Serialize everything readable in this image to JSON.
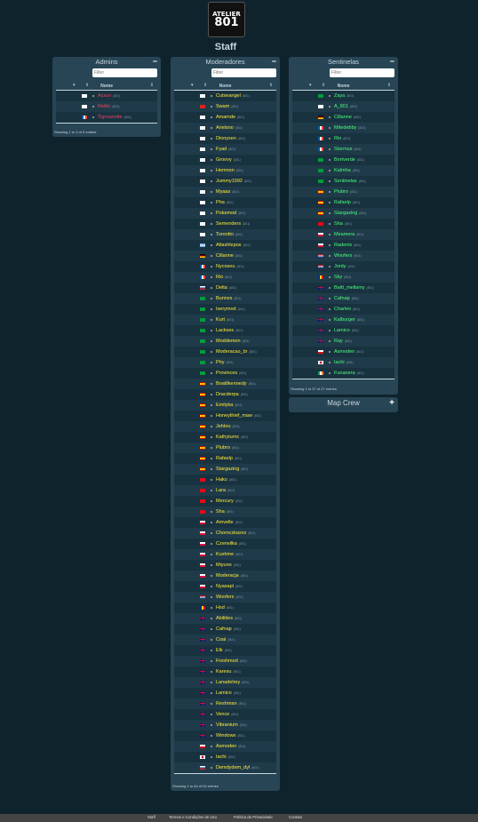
{
  "logo": {
    "line1": "ATELIER",
    "line2": "801"
  },
  "page_title": "Staff",
  "panels": {
    "admins": {
      "title": "Admins",
      "toggle": "−",
      "filter_placeholder": "Filter",
      "col_name": "Nome",
      "info": "Showing 1 to 3 of 3 entries",
      "rows": [
        {
          "name": "Acsun",
          "sub": "(801)",
          "flag": "kr",
          "color": "#f04060"
        },
        {
          "name": "Reitto",
          "sub": "(801)",
          "flag": "kr",
          "color": "#f04060"
        },
        {
          "name": "Tigrounette",
          "sub": "(801)",
          "flag": "fr",
          "color": "#f04060"
        }
      ]
    },
    "moderadores": {
      "title": "Moderadores",
      "toggle": "−",
      "filter_placeholder": "Filter",
      "col_name": "Nome",
      "info": "Showing 1 to 64 of 64 entries",
      "rows": [
        {
          "name": "Cutseangel",
          "sub": "(801)",
          "flag": "kr",
          "color": "#ffeb3b"
        },
        {
          "name": "Swam",
          "sub": "(801)",
          "flag": "vn",
          "color": "#ffeb3b"
        },
        {
          "name": "Amamde",
          "sub": "(801)",
          "flag": "kr",
          "color": "#ffeb3b"
        },
        {
          "name": "Arielsno",
          "sub": "(801)",
          "flag": "kr",
          "color": "#ffeb3b"
        },
        {
          "name": "Dionysen",
          "sub": "(801)",
          "flag": "kr",
          "color": "#ffeb3b"
        },
        {
          "name": "Fyad",
          "sub": "(801)",
          "flag": "kr",
          "color": "#ffeb3b"
        },
        {
          "name": "Groovy",
          "sub": "(801)",
          "flag": "kr",
          "color": "#ffeb3b"
        },
        {
          "name": "Hemnon",
          "sub": "(801)",
          "flag": "kr",
          "color": "#ffeb3b"
        },
        {
          "name": "Jummy1992",
          "sub": "(801)",
          "flag": "kr",
          "color": "#ffeb3b"
        },
        {
          "name": "Myaas",
          "sub": "(801)",
          "flag": "kr",
          "color": "#ffeb3b"
        },
        {
          "name": "Pha",
          "sub": "(801)",
          "flag": "kr",
          "color": "#ffeb3b"
        },
        {
          "name": "Pokemod",
          "sub": "(801)",
          "flag": "kr",
          "color": "#ffeb3b"
        },
        {
          "name": "Semenders",
          "sub": "(801)",
          "flag": "kr",
          "color": "#ffeb3b"
        },
        {
          "name": "Torontto",
          "sub": "(801)",
          "flag": "kr",
          "color": "#ffeb3b"
        },
        {
          "name": "Atlashlepos",
          "sub": "(801)",
          "flag": "ar",
          "color": "#ffeb3b"
        },
        {
          "name": "Cillanne",
          "sub": "(801)",
          "flag": "de",
          "color": "#ffeb3b"
        },
        {
          "name": "Nycoseu",
          "sub": "(801)",
          "flag": "fr",
          "color": "#ffeb3b"
        },
        {
          "name": "Rio",
          "sub": "(801)",
          "flag": "fr",
          "color": "#ffeb3b"
        },
        {
          "name": "Delta",
          "sub": "(801)",
          "flag": "ru",
          "color": "#ffeb3b"
        },
        {
          "name": "Bunnxs",
          "sub": "(801)",
          "flag": "br",
          "color": "#ffeb3b"
        },
        {
          "name": "Iserymod",
          "sub": "(801)",
          "flag": "br",
          "color": "#ffeb3b"
        },
        {
          "name": "Kurt",
          "sub": "(801)",
          "flag": "br",
          "color": "#ffeb3b"
        },
        {
          "name": "Lackses",
          "sub": "(801)",
          "flag": "br",
          "color": "#ffeb3b"
        },
        {
          "name": "Moddemon",
          "sub": "(801)",
          "flag": "br",
          "color": "#ffeb3b"
        },
        {
          "name": "Moderacao_br",
          "sub": "(801)",
          "flag": "br",
          "color": "#ffeb3b"
        },
        {
          "name": "Phy",
          "sub": "(801)",
          "flag": "br",
          "color": "#ffeb3b"
        },
        {
          "name": "Provinces",
          "sub": "(801)",
          "flag": "br",
          "color": "#ffeb3b"
        },
        {
          "name": "Boatlikennedy",
          "sub": "(801)",
          "flag": "es",
          "color": "#ffeb3b"
        },
        {
          "name": "Dracderpa",
          "sub": "(801)",
          "flag": "es",
          "color": "#ffeb3b"
        },
        {
          "name": "Emilyka",
          "sub": "(801)",
          "flag": "es",
          "color": "#ffeb3b"
        },
        {
          "name": "Honeythief_maw",
          "sub": "(801)",
          "flag": "es",
          "color": "#ffeb3b"
        },
        {
          "name": "Jehtou",
          "sub": "(801)",
          "flag": "es",
          "color": "#ffeb3b"
        },
        {
          "name": "Kathyturnc",
          "sub": "(801)",
          "flag": "es",
          "color": "#ffeb3b"
        },
        {
          "name": "Plubro",
          "sub": "(801)",
          "flag": "es",
          "color": "#ffeb3b"
        },
        {
          "name": "Rafaelp",
          "sub": "(801)",
          "flag": "es",
          "color": "#ffeb3b"
        },
        {
          "name": "Stargazing",
          "sub": "(801)",
          "flag": "es",
          "color": "#ffeb3b"
        },
        {
          "name": "Haku",
          "sub": "(801)",
          "flag": "tr",
          "color": "#ffeb3b"
        },
        {
          "name": "Lara",
          "sub": "(801)",
          "flag": "tr",
          "color": "#ffeb3b"
        },
        {
          "name": "Mercury",
          "sub": "(801)",
          "flag": "tr",
          "color": "#ffeb3b"
        },
        {
          "name": "Sha",
          "sub": "(801)",
          "flag": "tr",
          "color": "#ffeb3b"
        },
        {
          "name": "Amvelle",
          "sub": "(801)",
          "flag": "pl",
          "color": "#ffeb3b"
        },
        {
          "name": "Chomczkaxxx",
          "sub": "(801)",
          "flag": "pl",
          "color": "#ffeb3b"
        },
        {
          "name": "Czerwilka",
          "sub": "(801)",
          "flag": "pl",
          "color": "#ffeb3b"
        },
        {
          "name": "Kushme",
          "sub": "(801)",
          "flag": "pl",
          "color": "#ffeb3b"
        },
        {
          "name": "Miyuno",
          "sub": "(801)",
          "flag": "pl",
          "color": "#ffeb3b"
        },
        {
          "name": "Moderacja",
          "sub": "(801)",
          "flag": "pl",
          "color": "#ffeb3b"
        },
        {
          "name": "Nyasapl",
          "sub": "(801)",
          "flag": "pl",
          "color": "#ffeb3b"
        },
        {
          "name": "Woofers",
          "sub": "(801)",
          "flag": "nl",
          "color": "#ffeb3b"
        },
        {
          "name": "Hsd",
          "sub": "(801)",
          "flag": "ro",
          "color": "#ffeb3b"
        },
        {
          "name": "Abilities",
          "sub": "(801)",
          "flag": "gb",
          "color": "#ffeb3b"
        },
        {
          "name": "Cafnap",
          "sub": "(801)",
          "flag": "gb",
          "color": "#ffeb3b"
        },
        {
          "name": "Coal",
          "sub": "(801)",
          "flag": "gb",
          "color": "#ffeb3b"
        },
        {
          "name": "Elk",
          "sub": "(801)",
          "flag": "gb",
          "color": "#ffeb3b"
        },
        {
          "name": "Freshmod",
          "sub": "(801)",
          "flag": "gb",
          "color": "#ffeb3b"
        },
        {
          "name": "Karesu",
          "sub": "(801)",
          "flag": "gb",
          "color": "#ffeb3b"
        },
        {
          "name": "Lanadelrey",
          "sub": "(801)",
          "flag": "gb",
          "color": "#ffeb3b"
        },
        {
          "name": "Lamico",
          "sub": "(801)",
          "flag": "gb",
          "color": "#ffeb3b"
        },
        {
          "name": "Reshman",
          "sub": "(801)",
          "flag": "gb",
          "color": "#ffeb3b"
        },
        {
          "name": "Vence",
          "sub": "(801)",
          "flag": "gb",
          "color": "#ffeb3b"
        },
        {
          "name": "Vibranium",
          "sub": "(801)",
          "flag": "gb",
          "color": "#ffeb3b"
        },
        {
          "name": "Windows",
          "sub": "(801)",
          "flag": "gb",
          "color": "#ffeb3b"
        },
        {
          "name": "Asmoden",
          "sub": "(801)",
          "flag": "cz",
          "color": "#ffeb3b"
        },
        {
          "name": "Iachi",
          "sub": "(801)",
          "flag": "jp",
          "color": "#ffeb3b"
        },
        {
          "name": "Demdydem_dyl",
          "sub": "(801)",
          "flag": "ru",
          "color": "#ffeb3b"
        }
      ]
    },
    "sentinelas": {
      "title": "Sentinelas",
      "toggle": "−",
      "filter_placeholder": "Filter",
      "col_name": "Nome",
      "info": "Showing 1 to 27 of 27 entries",
      "rows": [
        {
          "name": "Zaya",
          "sub": "(801)",
          "flag": "br",
          "color": "#4cff7a"
        },
        {
          "name": "A_801",
          "sub": "(801)",
          "flag": "kr",
          "color": "#4cff7a"
        },
        {
          "name": "Cillanne",
          "sub": "(801)",
          "flag": "de",
          "color": "#4cff7a"
        },
        {
          "name": "Mitedebby",
          "sub": "(801)",
          "flag": "fr",
          "color": "#4cff7a"
        },
        {
          "name": "Rio",
          "sub": "(801)",
          "flag": "fr",
          "color": "#4cff7a"
        },
        {
          "name": "Stormus",
          "sub": "(801)",
          "flag": "fr",
          "color": "#4cff7a"
        },
        {
          "name": "Bortverde",
          "sub": "(801)",
          "flag": "br",
          "color": "#4cff7a"
        },
        {
          "name": "Kalmha",
          "sub": "(801)",
          "flag": "br",
          "color": "#4cff7a"
        },
        {
          "name": "Sentinelas",
          "sub": "(801)",
          "flag": "br",
          "color": "#4cff7a"
        },
        {
          "name": "Plubro",
          "sub": "(801)",
          "flag": "es",
          "color": "#4cff7a"
        },
        {
          "name": "Rafaelp",
          "sub": "(801)",
          "flag": "es",
          "color": "#4cff7a"
        },
        {
          "name": "Stargazing",
          "sub": "(801)",
          "flag": "es",
          "color": "#4cff7a"
        },
        {
          "name": "Sha",
          "sub": "(801)",
          "flag": "tr",
          "color": "#4cff7a"
        },
        {
          "name": "Meamera",
          "sub": "(801)",
          "flag": "pl",
          "color": "#4cff7a"
        },
        {
          "name": "Radenis",
          "sub": "(801)",
          "flag": "pl",
          "color": "#4cff7a"
        },
        {
          "name": "Woofers",
          "sub": "(801)",
          "flag": "nl",
          "color": "#4cff7a"
        },
        {
          "name": "Jordy",
          "sub": "(801)",
          "flag": "nl",
          "color": "#4cff7a"
        },
        {
          "name": "Sky",
          "sub": "(801)",
          "flag": "ro",
          "color": "#4cff7a"
        },
        {
          "name": "Baltt_mellamy",
          "sub": "(801)",
          "flag": "gb",
          "color": "#4cff7a"
        },
        {
          "name": "Cafnap",
          "sub": "(801)",
          "flag": "gb",
          "color": "#4cff7a"
        },
        {
          "name": "Charlen",
          "sub": "(801)",
          "flag": "gb",
          "color": "#4cff7a"
        },
        {
          "name": "Kalburger",
          "sub": "(801)",
          "flag": "gb",
          "color": "#4cff7a"
        },
        {
          "name": "Lamico",
          "sub": "(801)",
          "flag": "gb",
          "color": "#4cff7a"
        },
        {
          "name": "Ray",
          "sub": "(801)",
          "flag": "gb",
          "color": "#4cff7a"
        },
        {
          "name": "Asmoden",
          "sub": "(801)",
          "flag": "cz",
          "color": "#4cff7a"
        },
        {
          "name": "Iachi",
          "sub": "(801)",
          "flag": "jp",
          "color": "#4cff7a"
        },
        {
          "name": "Funanera",
          "sub": "(801)",
          "flag": "ie",
          "color": "#4cff7a"
        }
      ]
    },
    "mapcrew": {
      "title": "Map Crew",
      "toggle": "+"
    }
  },
  "footer": {
    "links": [
      "Staff",
      "Termos e Condições de Uso",
      "Política de Privacidade",
      "Contato"
    ]
  }
}
